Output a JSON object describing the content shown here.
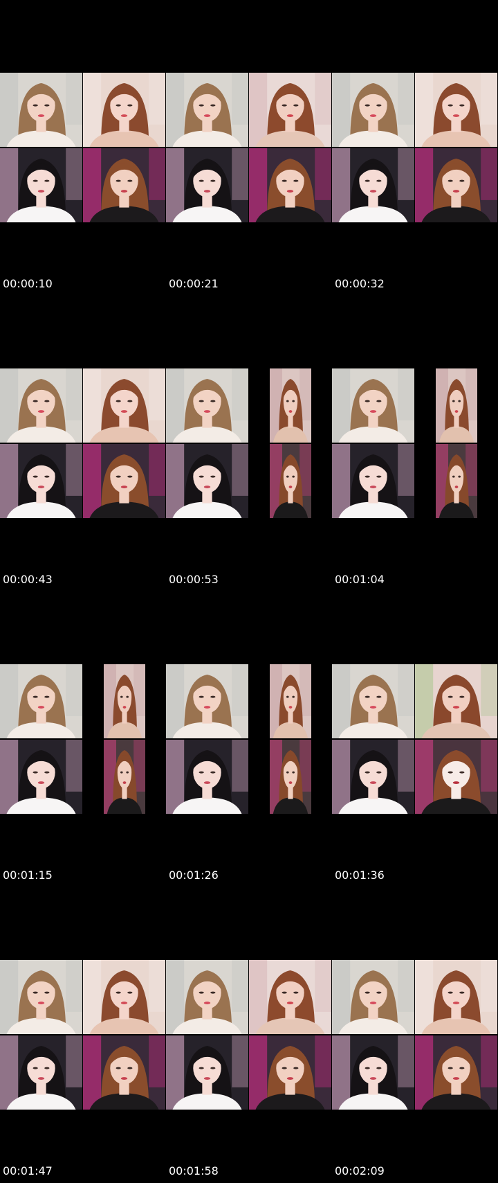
{
  "contact_sheet": {
    "background": "#000000",
    "text_color": "#ffffff",
    "rows": [
      {
        "timestamps": [
          "00:00:10",
          "00:00:21",
          "00:00:32"
        ],
        "frames": [
          {
            "top": "blonde-white-chair",
            "bottom": "black-hair-pink-chair"
          },
          {
            "top": "auburn-lace-bokeh",
            "bottom": "auburn-pink-room"
          },
          {
            "top": "blonde-white-chair",
            "bottom": "black-hair-pink-chair"
          },
          {
            "top": "auburn-floral-arm-raised",
            "bottom": "auburn-pink-room"
          },
          {
            "top": "blonde-white-chair",
            "bottom": "black-hair-pink-chair"
          },
          {
            "top": "auburn-lace-bokeh",
            "bottom": "auburn-pink-room"
          }
        ]
      },
      {
        "timestamps": [
          "00:00:43",
          "00:00:53",
          "00:01:04"
        ],
        "frames": [
          {
            "top": "blonde-white-chair",
            "bottom": "black-hair-pink-chair"
          },
          {
            "top": "auburn-lace-bokeh",
            "bottom": "auburn-pink-room"
          },
          {
            "top": "blonde-white-chair",
            "bottom": "black-hair-pink-chair"
          },
          {
            "top": "auburn-floral-narrow",
            "bottom": "auburn-room-narrow"
          },
          {
            "top": "blonde-white-chair",
            "bottom": "black-hair-pink-chair"
          },
          {
            "top": "auburn-floral-narrow",
            "bottom": "auburn-room-narrow"
          }
        ]
      },
      {
        "timestamps": [
          "00:01:15",
          "00:01:26",
          "00:01:36"
        ],
        "frames": [
          {
            "top": "blonde-white-chair",
            "bottom": "black-hair-pink-chair"
          },
          {
            "top": "auburn-floral-narrow",
            "bottom": "auburn-room-narrow"
          },
          {
            "top": "blonde-white-chair",
            "bottom": "black-hair-pink-chair"
          },
          {
            "top": "auburn-floral-narrow",
            "bottom": "auburn-room-narrow"
          },
          {
            "top": "blonde-white-chair",
            "bottom": "black-hair-pink-chair"
          },
          {
            "top": "auburn-floral-flower",
            "bottom": "auburn-face-mask"
          }
        ]
      },
      {
        "timestamps": [
          "00:01:47",
          "00:01:58",
          "00:02:09"
        ],
        "frames": [
          {
            "top": "blonde-white-chair",
            "bottom": "black-hair-pink-chair"
          },
          {
            "top": "auburn-lace-bokeh",
            "bottom": "auburn-pink-room"
          },
          {
            "top": "blonde-white-chair",
            "bottom": "black-hair-pink-chair"
          },
          {
            "top": "auburn-floral-arm-raised",
            "bottom": "auburn-pink-room"
          },
          {
            "top": "blonde-white-chair",
            "bottom": "black-hair-pink-chair"
          },
          {
            "top": "auburn-lace-bokeh",
            "bottom": "auburn-pink-room"
          }
        ]
      }
    ]
  }
}
